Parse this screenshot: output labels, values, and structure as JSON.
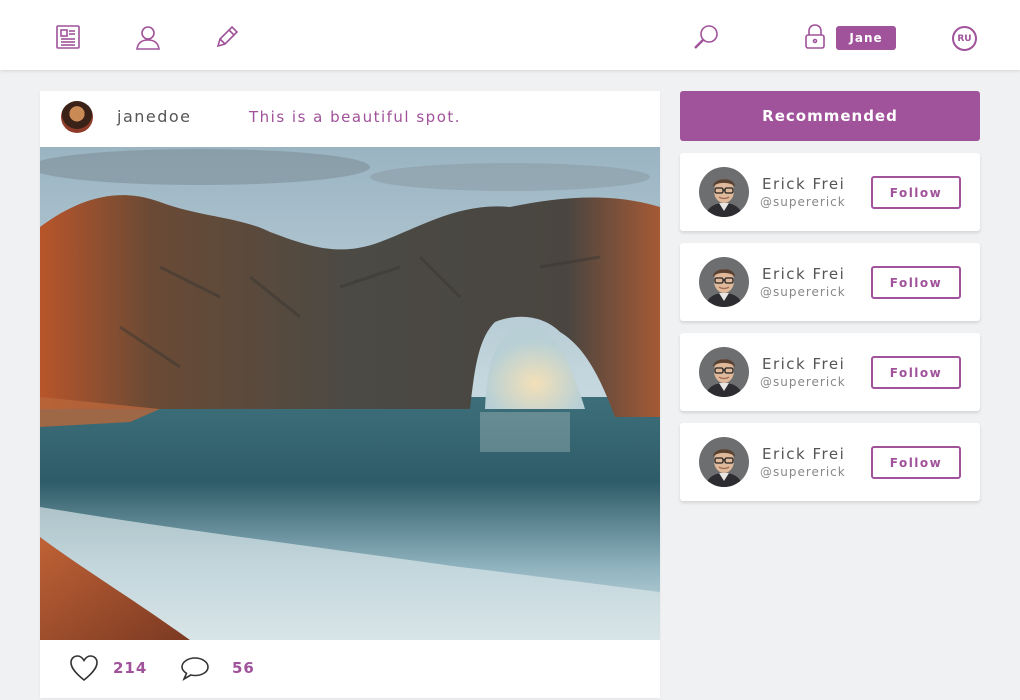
{
  "nav": {
    "icons": [
      "newspaper-icon",
      "user-icon",
      "pencil-icon",
      "search-icon",
      "lock-icon"
    ],
    "user_label": "Jane",
    "language": "RU"
  },
  "post": {
    "username": "janedoe",
    "caption": "This is a beautiful spot.",
    "likes": "214",
    "comments": "56"
  },
  "recommended": {
    "title": "Recommended",
    "users": [
      {
        "name": "Erick Frei",
        "handle": "@supererick",
        "button": "Follow"
      },
      {
        "name": "Erick Frei",
        "handle": "@supererick",
        "button": "Follow"
      },
      {
        "name": "Erick Frei",
        "handle": "@supererick",
        "button": "Follow"
      },
      {
        "name": "Erick Frei",
        "handle": "@supererick",
        "button": "Follow"
      }
    ]
  },
  "colors": {
    "accent": "#a0529a",
    "background": "#f0f1f3",
    "card": "#ffffff"
  }
}
